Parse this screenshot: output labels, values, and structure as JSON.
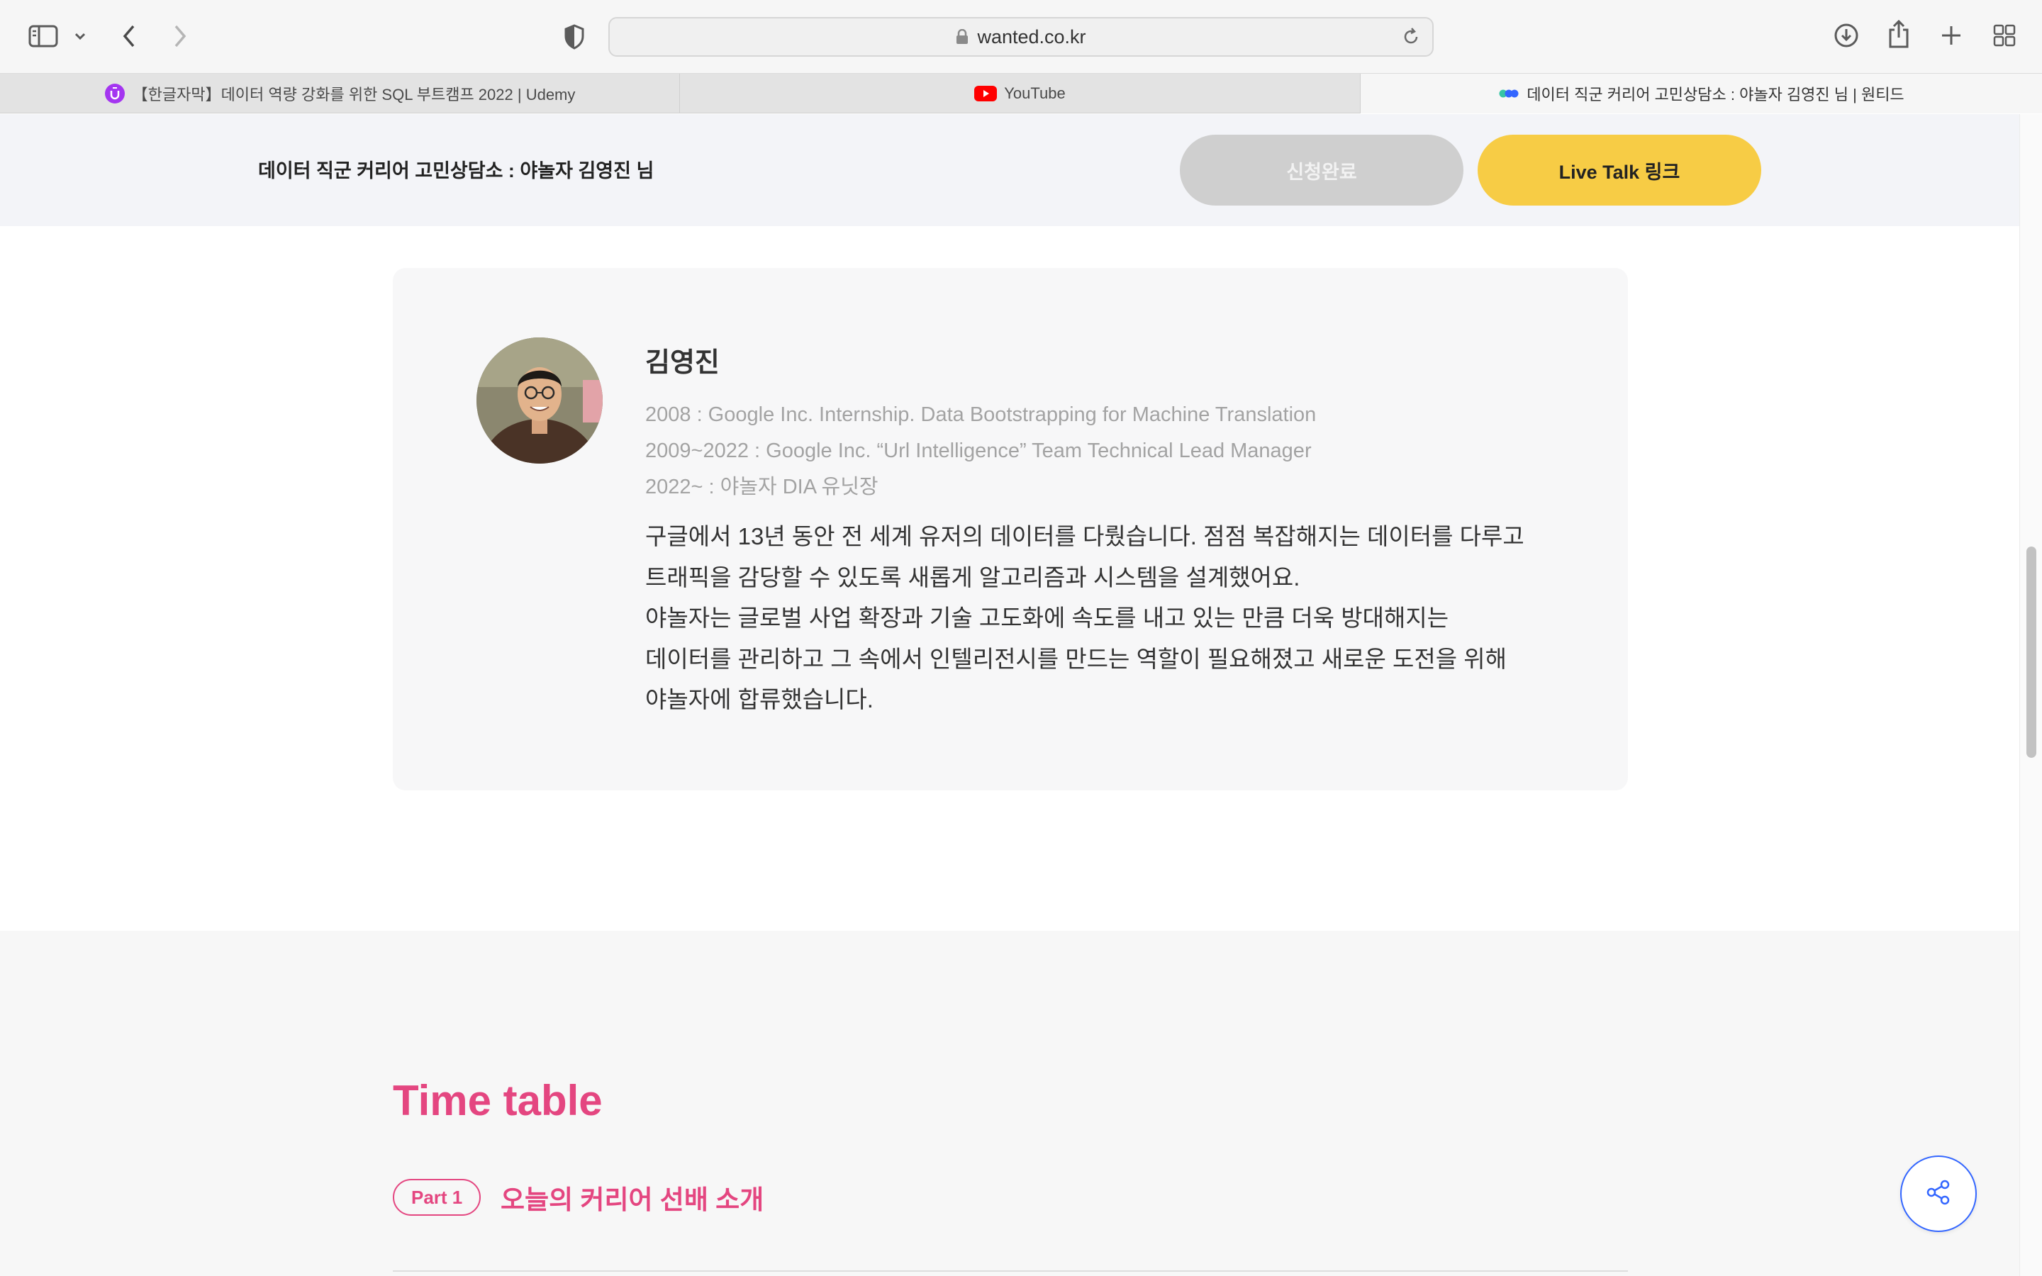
{
  "browser": {
    "address": "wanted.co.kr",
    "tabs": [
      {
        "label": "【한글자막】데이터 역량 강화를 위한 SQL 부트캠프 2022 | Udemy",
        "icon": "udemy-icon"
      },
      {
        "label": "YouTube",
        "icon": "youtube-icon"
      },
      {
        "label": "데이터 직군 커리어 고민상담소 : 야놀자 김영진 님 | 원티드",
        "icon": "wanted-icon"
      }
    ]
  },
  "header": {
    "title": "데이터 직군 커리어 고민상담소 : 야놀자 김영진 님",
    "applied_label": "신청완료",
    "live_label": "Live Talk 링크"
  },
  "profile": {
    "name": "김영진",
    "career": [
      "2008 : Google Inc. Internship. Data Bootstrapping for Machine Translation",
      "2009~2022 : Google Inc. “Url Intelligence” Team Technical Lead Manager",
      "2022~ : 야놀자 DIA 유닛장"
    ],
    "bio": [
      "구글에서 13년 동안 전 세계 유저의 데이터를 다뤘습니다. 점점 복잡해지는 데이터를 다루고",
      "트래픽을 감당할 수 있도록 새롭게 알고리즘과 시스템을 설계했어요.",
      "야놀자는 글로벌 사업 확장과 기술 고도화에 속도를 내고 있는 만큼 더욱 방대해지는",
      "데이터를 관리하고 그 속에서 인텔리전시를 만드는 역할이 필요해졌고 새로운 도전을 위해",
      "야놀자에 합류했습니다."
    ]
  },
  "timetable": {
    "title": "Time table",
    "part_badge": "Part 1",
    "part_title": "오늘의 커리어 선배 소개"
  },
  "colors": {
    "accent_pink": "#e44680",
    "live_yellow": "#f7cc45",
    "applied_gray": "#cfcfcf",
    "share_blue": "#3366ff"
  }
}
